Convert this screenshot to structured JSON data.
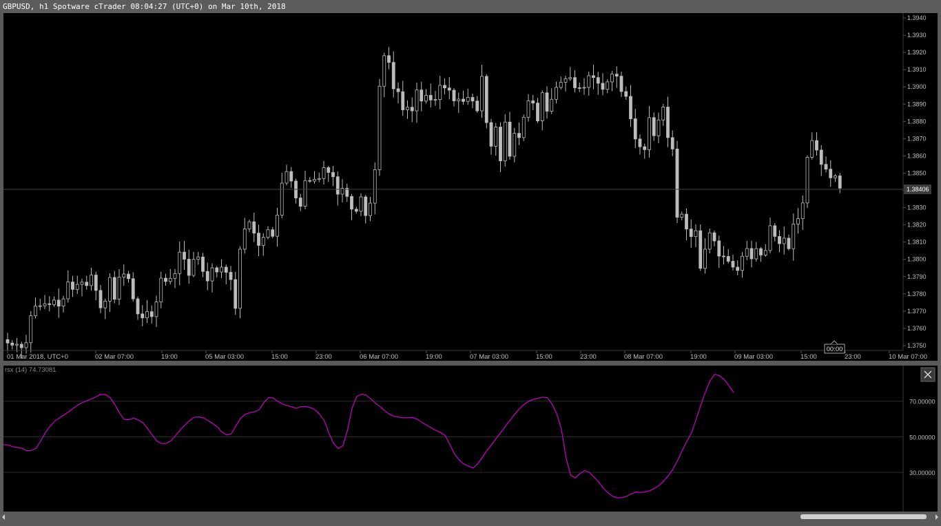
{
  "window": {
    "title": "GBPUSD, h1 Spotware cTrader 08:04:27 (UTC+0) on Mar 10th, 2018"
  },
  "colors": {
    "background": "#000000",
    "candle": "#bdbdbd",
    "rsx_line": "#cc00cc",
    "price_label_bg": "#3d3d3d",
    "axis_text": "#bfbfbf"
  },
  "price_axis": {
    "labels": [
      "1.3940",
      "1.3930",
      "1.3920",
      "1.3910",
      "1.3900",
      "1.3890",
      "1.3880",
      "1.3870",
      "1.3860",
      "1.3850",
      "1.3840",
      "1.3830",
      "1.3820",
      "1.3810",
      "1.3800",
      "1.3790",
      "1.3780",
      "1.3770",
      "1.3760",
      "1.3750"
    ],
    "current_price": "1.38406"
  },
  "time_axis": {
    "labels": [
      "01 Mar 2018, UTC+0",
      "02 Mar 07:00",
      "19:00",
      "05 Mar 03:00",
      "15:00",
      "23:00",
      "06 Mar 07:00",
      "19:00",
      "07 Mar 03:00",
      "15:00",
      "23:00",
      "08 Mar 07:00",
      "19:00",
      "09 Mar 03:00",
      "15:00",
      "23:00",
      "10 Mar 07:00"
    ],
    "cursor_label": "00:00"
  },
  "indicator": {
    "title": "rsx (14) 74.73081",
    "axis_labels": [
      "70.00000",
      "50.00000",
      "30.00000"
    ],
    "close_icon": "close-icon"
  },
  "chart_data": [
    {
      "type": "candlestick",
      "symbol": "GBPUSD",
      "timeframe": "h1",
      "ylim": [
        1.375,
        1.394
      ],
      "last_price": 1.38406,
      "grid": false,
      "close": [
        1.37515,
        1.37503,
        1.37508,
        1.37488,
        1.37517,
        1.37673,
        1.37729,
        1.37731,
        1.37743,
        1.37738,
        1.37764,
        1.37729,
        1.37771,
        1.37869,
        1.37826,
        1.37855,
        1.37868,
        1.37848,
        1.37909,
        1.3782,
        1.37719,
        1.37758,
        1.37895,
        1.37769,
        1.37897,
        1.37915,
        1.37888,
        1.37771,
        1.37684,
        1.37661,
        1.37697,
        1.37668,
        1.37753,
        1.37891,
        1.37872,
        1.3789,
        1.37918,
        1.38042,
        1.38001,
        1.37907,
        1.38,
        1.38014,
        1.3793,
        1.37875,
        1.37951,
        1.37927,
        1.37955,
        1.37925,
        1.37883,
        1.37716,
        1.38059,
        1.38177,
        1.38218,
        1.38152,
        1.38081,
        1.38128,
        1.38172,
        1.38134,
        1.38257,
        1.38442,
        1.38509,
        1.38454,
        1.38356,
        1.38308,
        1.38457,
        1.38454,
        1.38464,
        1.38469,
        1.38532,
        1.38504,
        1.38479,
        1.38378,
        1.38412,
        1.38365,
        1.38291,
        1.38279,
        1.38362,
        1.38254,
        1.38326,
        1.3852,
        1.39004,
        1.39181,
        1.39142,
        1.38989,
        1.38972,
        1.38867,
        1.38882,
        1.38861,
        1.38982,
        1.38918,
        1.38951,
        1.38924,
        1.38927,
        1.39009,
        1.38994,
        1.38981,
        1.38919,
        1.38929,
        1.38916,
        1.38939,
        1.38918,
        1.38861,
        1.39061,
        1.38793,
        1.38656,
        1.38767,
        1.38571,
        1.38796,
        1.38598,
        1.38731,
        1.38706,
        1.38824,
        1.38919,
        1.38906,
        1.38803,
        1.38966,
        1.38859,
        1.38928,
        1.38997,
        1.39027,
        1.39047,
        1.39054,
        1.38995,
        1.38994,
        1.38997,
        1.39065,
        1.39054,
        1.39021,
        1.38986,
        1.39029,
        1.39074,
        1.39062,
        1.38973,
        1.38945,
        1.38815,
        1.38698,
        1.38653,
        1.38636,
        1.38822,
        1.38717,
        1.38808,
        1.38883,
        1.38706,
        1.3864,
        1.38244,
        1.38262,
        1.38176,
        1.38132,
        1.38166,
        1.37948,
        1.38059,
        1.38154,
        1.38107,
        1.38019,
        1.38017,
        1.37989,
        1.37955,
        1.37936,
        1.38018,
        1.38063,
        1.38003,
        1.38062,
        1.38025,
        1.38051,
        1.38195,
        1.38133,
        1.38091,
        1.38123,
        1.38062,
        1.38205,
        1.38236,
        1.38327,
        1.38592,
        1.38689,
        1.38634,
        1.38551,
        1.38523,
        1.38473,
        1.38484,
        1.38413
      ]
    },
    {
      "type": "line",
      "name": "rsx (14)",
      "last_value": 74.73081,
      "ylim": [
        8,
        90
      ],
      "values": [
        45.6,
        45.4,
        44.4,
        44.0,
        43.5,
        42.2,
        42.3,
        43.5,
        47.6,
        52.2,
        55.9,
        58.7,
        60.5,
        62.3,
        64.0,
        66.0,
        67.8,
        69.3,
        70.3,
        71.3,
        72.6,
        73.8,
        73.7,
        71.8,
        67.9,
        63.2,
        59.7,
        59.6,
        60.5,
        59.5,
        57.8,
        54.6,
        51.0,
        47.6,
        46.2,
        46.3,
        47.7,
        50.7,
        53.8,
        56.5,
        59.0,
        60.9,
        61.2,
        60.6,
        59.1,
        57.5,
        55.5,
        52.6,
        51.0,
        51.7,
        56.2,
        60.4,
        62.6,
        63.6,
        64.0,
        65.3,
        69.1,
        72.0,
        71.8,
        69.9,
        68.4,
        67.6,
        66.7,
        66.1,
        66.9,
        67.0,
        66.4,
        65.2,
        62.6,
        59.1,
        52.1,
        46.2,
        43.4,
        45.0,
        53.8,
        66.4,
        72.7,
        74.0,
        73.4,
        71.3,
        68.9,
        66.9,
        64.6,
        62.7,
        61.5,
        61.0,
        60.7,
        60.8,
        60.8,
        59.9,
        58.1,
        56.5,
        55.1,
        53.6,
        52.4,
        50.7,
        45.7,
        40.3,
        37.0,
        34.7,
        33.5,
        32.5,
        34.8,
        38.5,
        42.4,
        45.6,
        49.2,
        52.6,
        56.1,
        59.5,
        62.9,
        65.8,
        68.3,
        70.0,
        71.1,
        71.7,
        72.3,
        71.9,
        68.3,
        62.9,
        54.2,
        37.9,
        28.4,
        26.9,
        29.3,
        31.0,
        30.0,
        27.4,
        24.6,
        21.2,
        18.6,
        16.6,
        15.7,
        15.8,
        16.5,
        17.9,
        19.0,
        18.7,
        19.0,
        19.7,
        21.0,
        22.7,
        25.1,
        28.2,
        31.9,
        36.8,
        42.4,
        47.6,
        52.4,
        60.1,
        68.0,
        75.4,
        81.7,
        85.2,
        84.3,
        82.2,
        78.7,
        75.0
      ]
    }
  ]
}
